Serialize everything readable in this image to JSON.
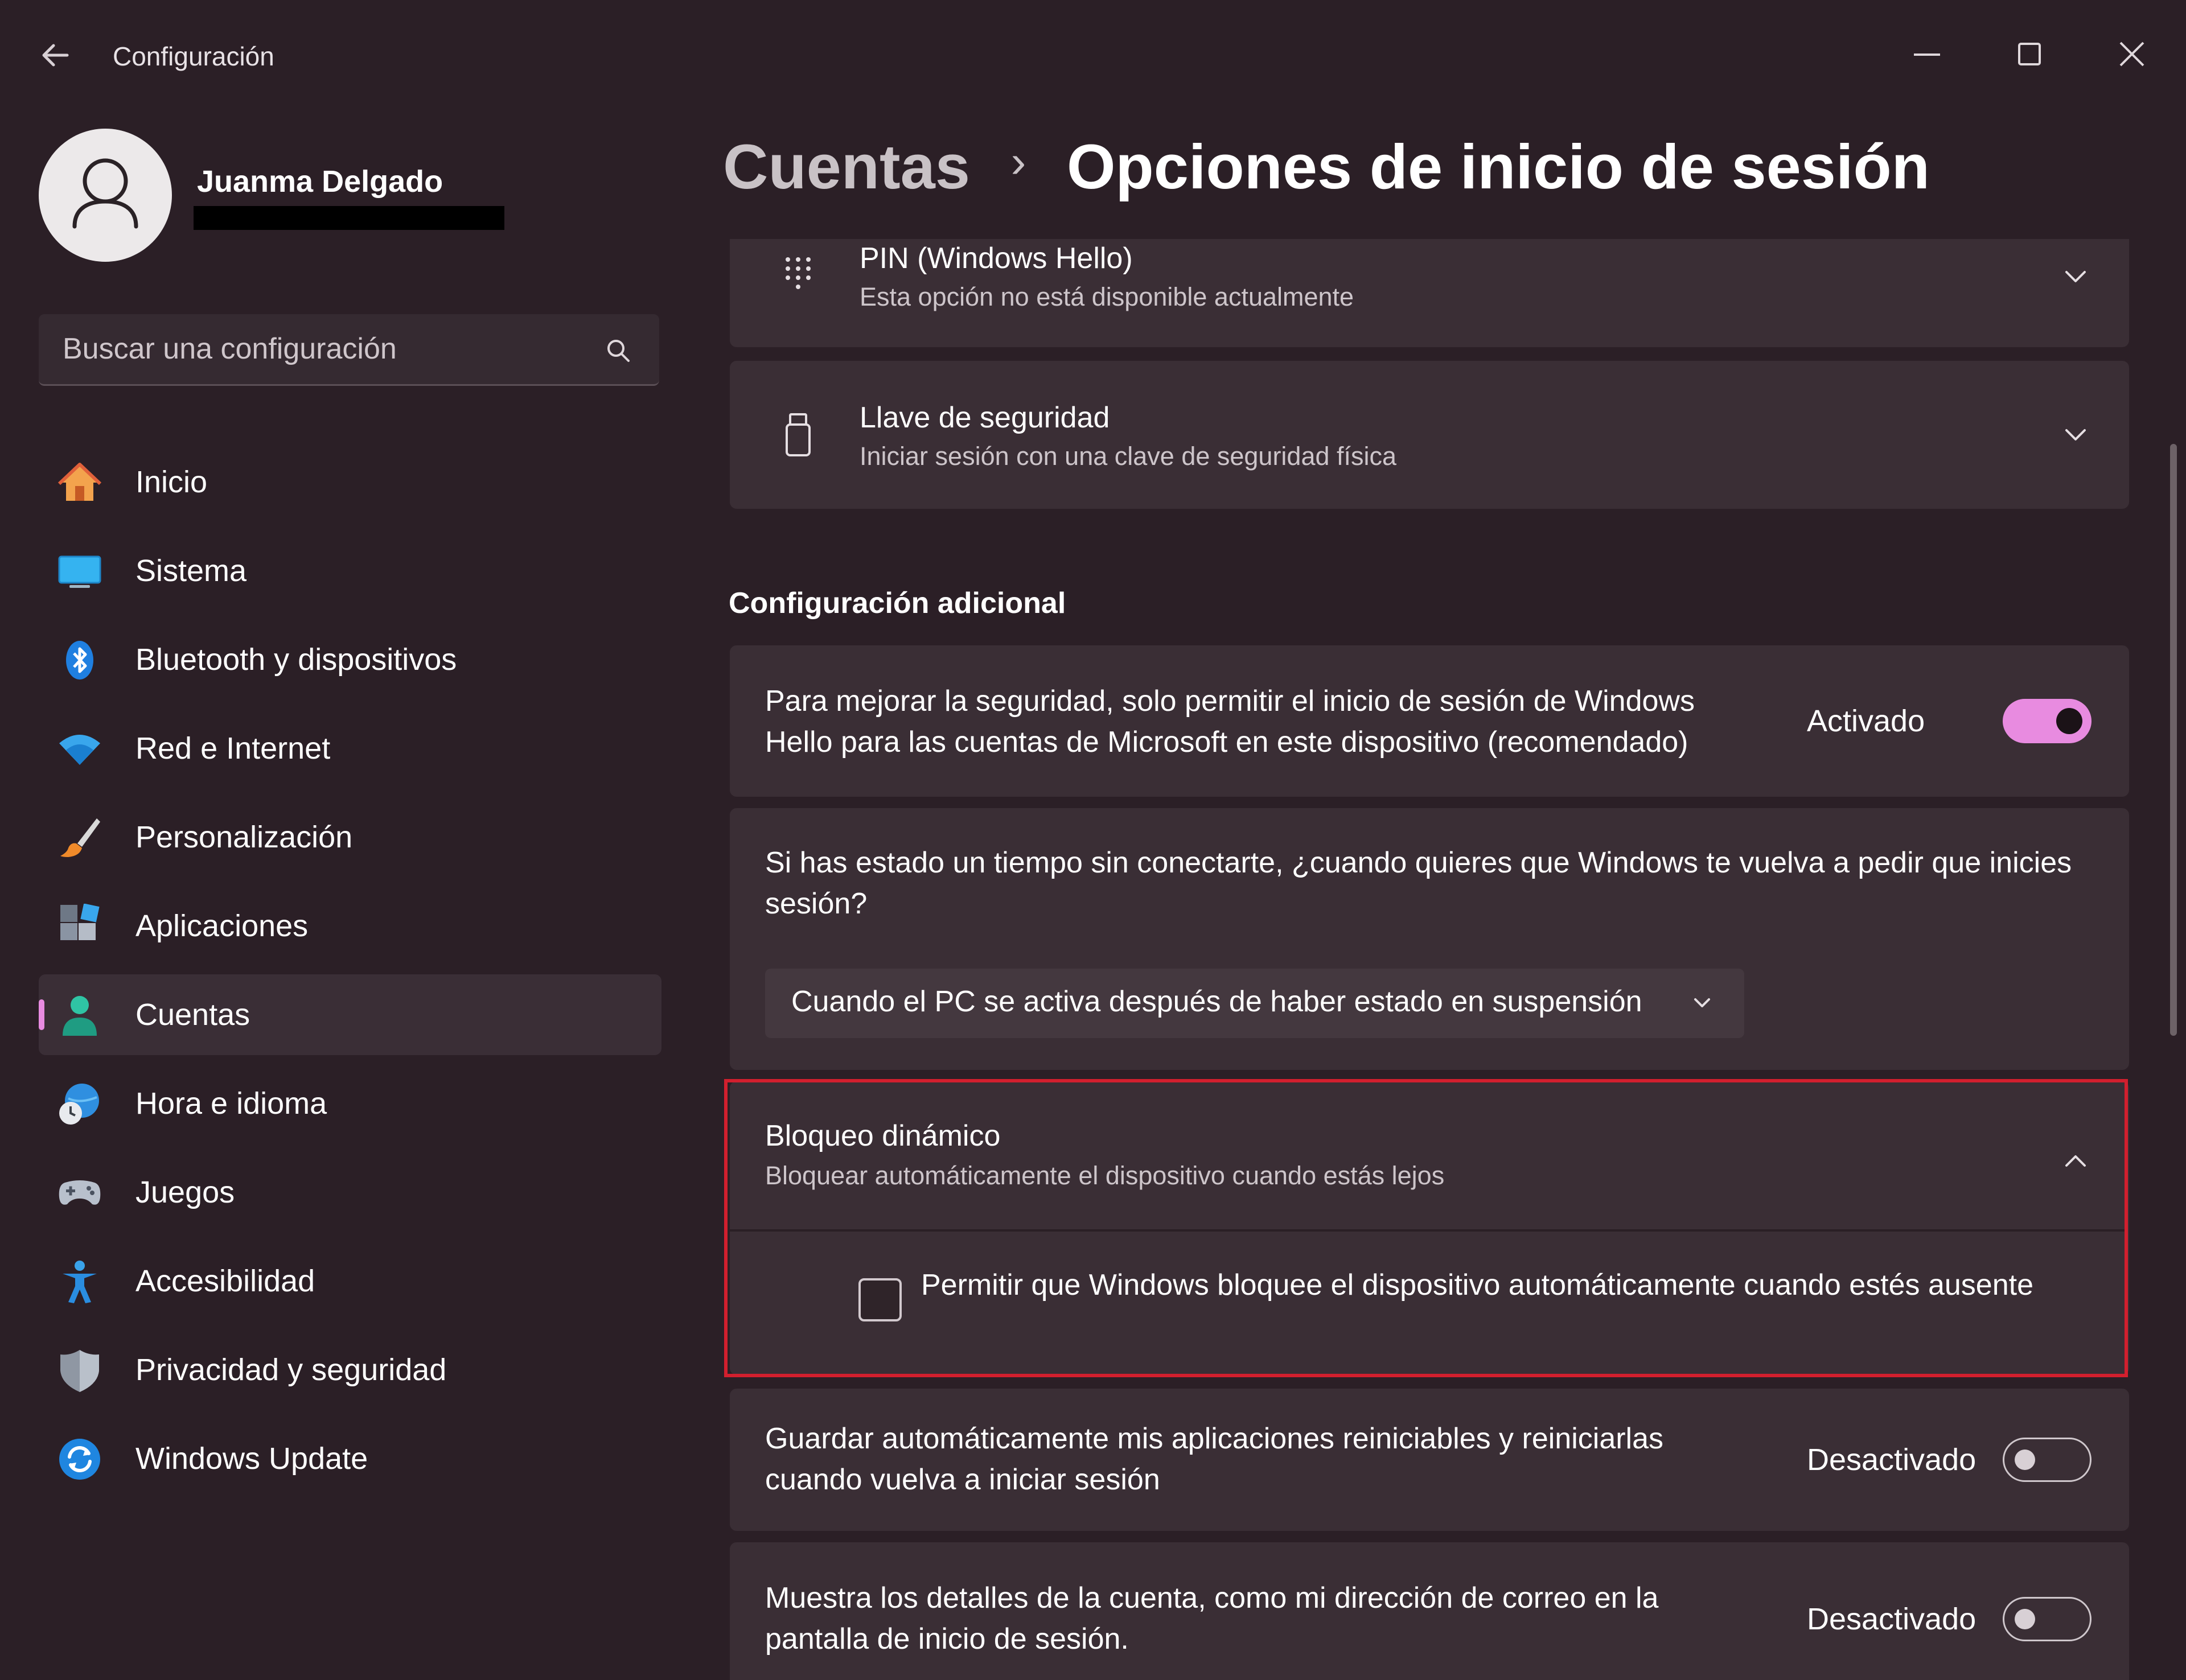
{
  "window": {
    "title": "Configuración"
  },
  "profile": {
    "name": "Juanma Delgado"
  },
  "search": {
    "placeholder": "Buscar una configuración"
  },
  "sidebar": {
    "items": [
      {
        "label": "Inicio",
        "icon": "home-icon"
      },
      {
        "label": "Sistema",
        "icon": "monitor-icon"
      },
      {
        "label": "Bluetooth y dispositivos",
        "icon": "bluetooth-icon"
      },
      {
        "label": "Red e Internet",
        "icon": "wifi-icon"
      },
      {
        "label": "Personalización",
        "icon": "brush-icon"
      },
      {
        "label": "Aplicaciones",
        "icon": "apps-icon"
      },
      {
        "label": "Cuentas",
        "icon": "person-icon",
        "active": true
      },
      {
        "label": "Hora e idioma",
        "icon": "globe-clock-icon"
      },
      {
        "label": "Juegos",
        "icon": "gamepad-icon"
      },
      {
        "label": "Accesibilidad",
        "icon": "accessibility-icon"
      },
      {
        "label": "Privacidad y seguridad",
        "icon": "shield-icon"
      },
      {
        "label": "Windows Update",
        "icon": "update-icon"
      }
    ]
  },
  "breadcrumb": {
    "parent": "Cuentas",
    "separator": "›",
    "current": "Opciones de inicio de sesión"
  },
  "signin_options": {
    "pin": {
      "title": "PIN (Windows Hello)",
      "subtitle": "Esta opción no está disponible actualmente"
    },
    "security_key": {
      "title": "Llave de seguridad",
      "subtitle": "Iniciar sesión con una clave de seguridad física"
    }
  },
  "additional": {
    "section_title": "Configuración adicional",
    "hello_only": {
      "text": "Para mejorar la seguridad, solo permitir el inicio de sesión de Windows Hello para las cuentas de Microsoft en este dispositivo (recomendado)",
      "state": "Activado",
      "on": true
    },
    "require_signin": {
      "text": "Si has estado un tiempo sin conectarte, ¿cuando quieres que Windows te vuelva a pedir que inicies sesión?",
      "selected": "Cuando el PC se activa después de haber estado en suspensión"
    },
    "dynamic_lock": {
      "title": "Bloqueo dinámico",
      "subtitle": "Bloquear automáticamente el dispositivo cuando estás lejos",
      "checkbox_label": "Permitir que Windows bloquee el dispositivo automáticamente cuando estés ausente",
      "checked": false,
      "highlight_color": "#d21f2e"
    },
    "restart_apps": {
      "text": "Guardar automáticamente mis aplicaciones reiniciables y reiniciarlas cuando vuelva a iniciar sesión",
      "state": "Desactivado",
      "on": false
    },
    "account_details": {
      "text": "Muestra los detalles de la cuenta, como mi dirección de correo en la pantalla de inicio de sesión.",
      "state": "Desactivado",
      "on": false
    }
  },
  "colors": {
    "accent": "#e88be0",
    "background": "#2b1f26",
    "card": "#3a2e35"
  }
}
